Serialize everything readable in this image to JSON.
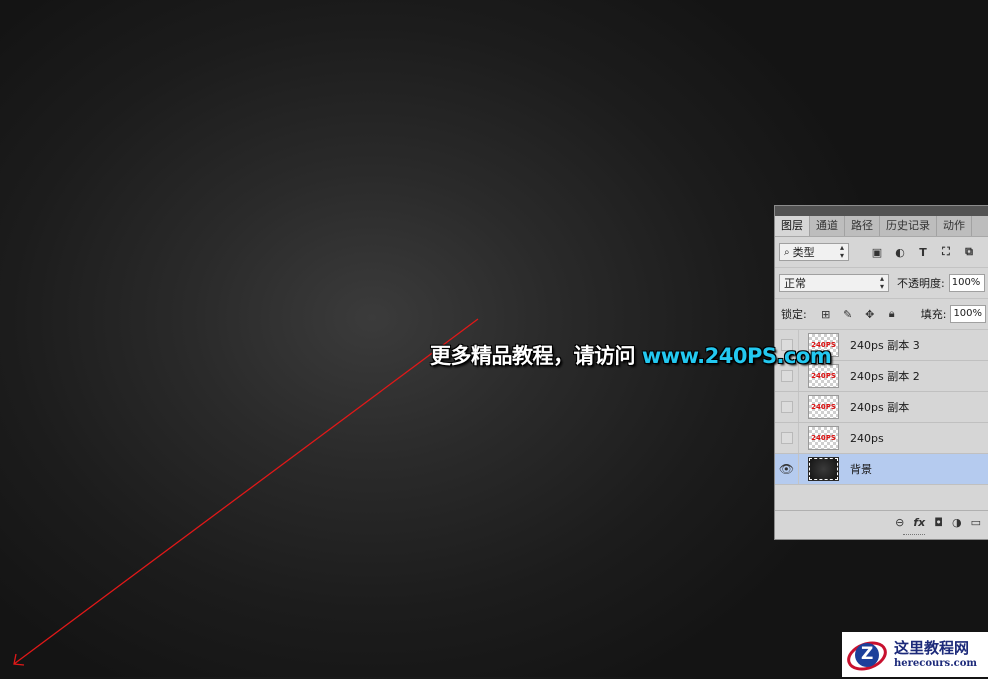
{
  "promo": {
    "text": "更多精品教程，请访问 ",
    "url": "www.240PS.com"
  },
  "colors": {
    "arrow": "#e01818",
    "promo_url": "#23c8f0",
    "selected_layer": "#b5cbef",
    "watermark_text": "#1c2a7a"
  },
  "layers_panel": {
    "tabs": [
      "图层",
      "通道",
      "路径",
      "历史记录",
      "动作"
    ],
    "active_tab": "图层",
    "filter": {
      "value": "类型",
      "icon": "search-icon"
    },
    "filter_icons": [
      "image-filter-icon",
      "adjustment-filter-icon",
      "type-filter-icon",
      "shape-filter-icon",
      "smart-object-filter-icon"
    ],
    "type_glyph": "T",
    "blend_mode": "正常",
    "opacity_label": "不透明度:",
    "opacity_value": "100%",
    "lock_label": "锁定:",
    "lock_icons": [
      "lock-transparent-icon",
      "lock-paint-icon",
      "lock-move-icon",
      "lock-all-icon"
    ],
    "fill_label": "填充:",
    "fill_value": "100%",
    "layers": [
      {
        "name": "240ps 副本 3",
        "visible": false,
        "thumb_text": "240PS",
        "selected": false
      },
      {
        "name": "240ps 副本 2",
        "visible": false,
        "thumb_text": "240PS",
        "selected": false
      },
      {
        "name": "240ps 副本",
        "visible": false,
        "thumb_text": "240PS",
        "selected": false
      },
      {
        "name": "240ps",
        "visible": false,
        "thumb_text": "240PS",
        "selected": false
      },
      {
        "name": "背景",
        "visible": true,
        "thumb_text": "",
        "selected": true
      }
    ],
    "footer_icons": [
      "link-layers-icon",
      "fx-icon",
      "mask-icon",
      "adjustment-layer-icon",
      "group-folder-icon"
    ],
    "fx_label": "fx"
  },
  "watermark": {
    "cn": "这里教程网",
    "en": "herecours.com",
    "logo_letter": "Z"
  }
}
